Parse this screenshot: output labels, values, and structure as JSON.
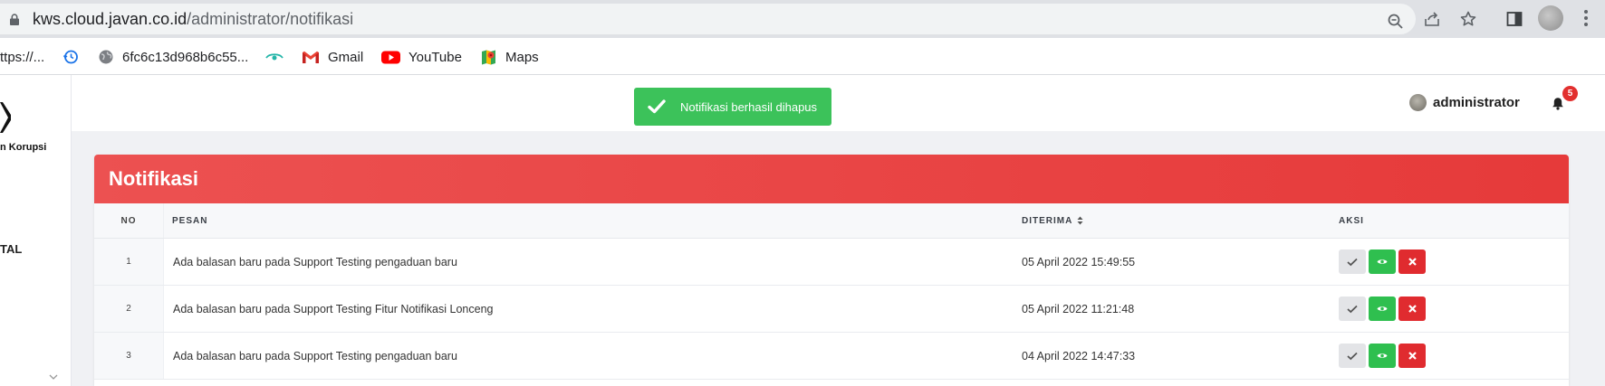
{
  "browser": {
    "url_host": "kws.cloud.javan.co.id",
    "url_path": "/administrator/notifikasi",
    "bookmarks": [
      {
        "label": "ttps://...",
        "icon": "globe-icon"
      },
      {
        "label": "",
        "icon": "history-icon"
      },
      {
        "label": "6fc6c13d968b6c55...",
        "icon": "globe-icon"
      },
      {
        "label": "",
        "icon": "eye-icon"
      },
      {
        "label": "Gmail",
        "icon": "gmail-icon"
      },
      {
        "label": "YouTube",
        "icon": "youtube-icon"
      },
      {
        "label": "Maps",
        "icon": "maps-icon"
      }
    ]
  },
  "sidebar": {
    "logo_text": "n Korupsi",
    "nav_fragment": "TAL"
  },
  "toast": {
    "message": "Notifikasi berhasil dihapus",
    "color": "#3cc25a"
  },
  "header": {
    "username": "administrator",
    "notification_count": "5"
  },
  "card": {
    "title": "Notifikasi",
    "header_color": "#e94545",
    "columns": {
      "no": "NO",
      "pesan": "PESAN",
      "diterima": "DITERIMA",
      "aksi": "AKSI"
    },
    "rows": [
      {
        "no": "1",
        "pesan": "Ada balasan baru pada Support Testing pengaduan baru",
        "diterima": "05 April 2022 15:49:55"
      },
      {
        "no": "2",
        "pesan": "Ada balasan baru pada Support Testing Fitur Notifikasi Lonceng",
        "diterima": "05 April 2022 11:21:48"
      },
      {
        "no": "3",
        "pesan": "Ada balasan baru pada Support Testing pengaduan baru",
        "diterima": "04 April 2022 14:47:33"
      }
    ]
  }
}
